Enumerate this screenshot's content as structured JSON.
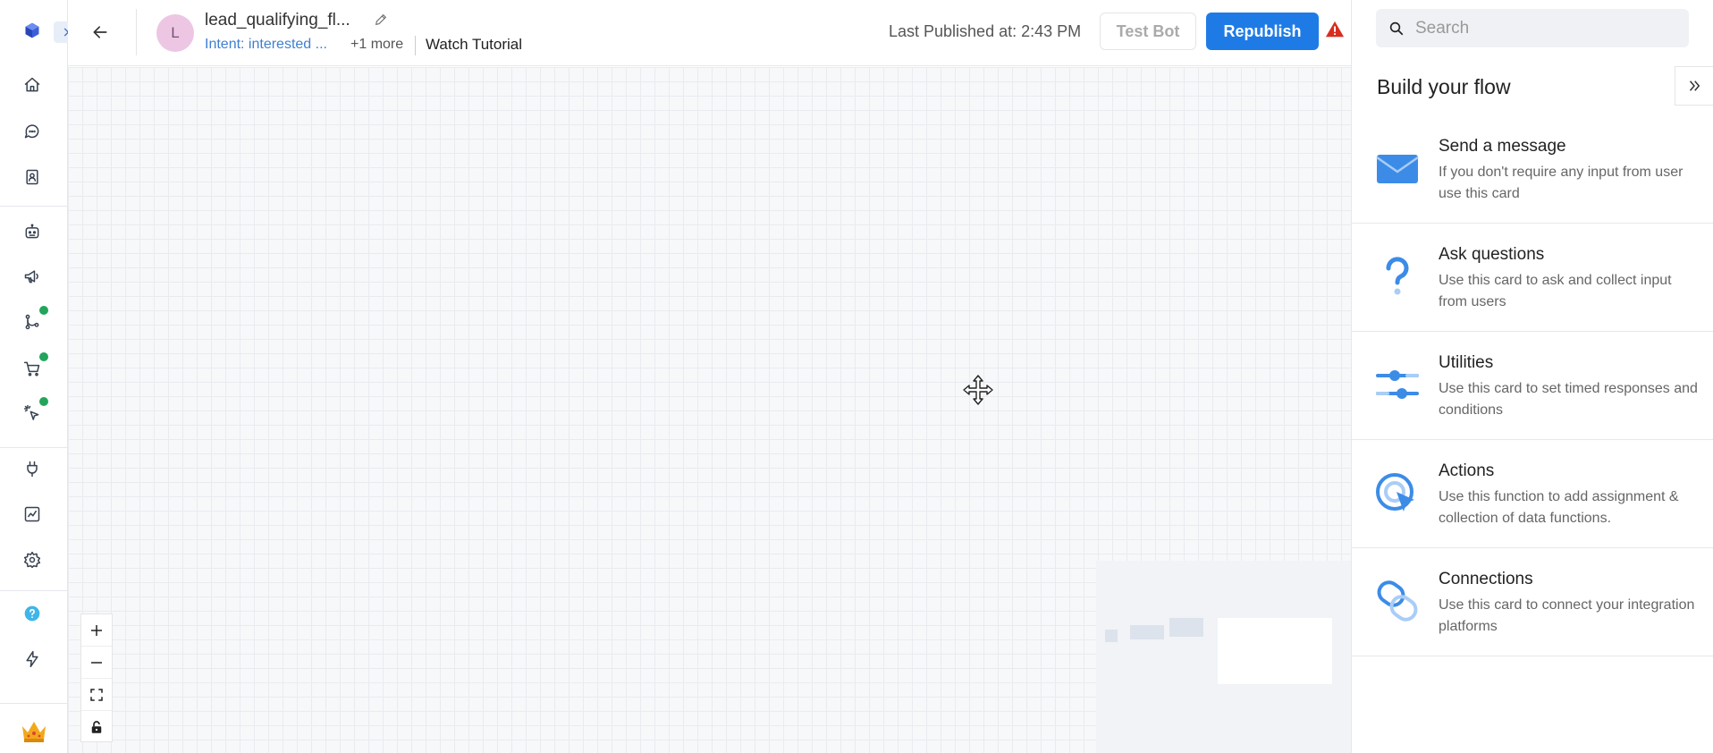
{
  "header": {
    "avatar_letter": "L",
    "flow_name": "lead_qualifying_fl...",
    "intent_label": "Intent: interested ...",
    "more_label": "+1 more",
    "watch_tutorial": "Watch Tutorial",
    "last_published": "Last Published at: 2:43 PM",
    "test_bot_label": "Test Bot",
    "republish_label": "Republish"
  },
  "search": {
    "placeholder": "Search"
  },
  "panel": {
    "title": "Build your flow",
    "cards": [
      {
        "title": "Send a message",
        "desc": "If you don't require any input from user use this card",
        "icon": "envelope-icon"
      },
      {
        "title": "Ask questions",
        "desc": "Use this card to ask and collect input from users",
        "icon": "question-mark-icon"
      },
      {
        "title": "Utilities",
        "desc": "Use this card to set timed responses and conditions",
        "icon": "sliders-icon"
      },
      {
        "title": "Actions",
        "desc": "Use this function to add assignment & collection of data functions.",
        "icon": "cursor-click-icon"
      },
      {
        "title": "Connections",
        "desc": "Use this card to connect your integration platforms",
        "icon": "link-icon"
      }
    ]
  },
  "colors": {
    "accent": "#1e7be6",
    "link": "#3f7fd1",
    "status_dot": "#22a55b",
    "warning": "#d92d20"
  }
}
